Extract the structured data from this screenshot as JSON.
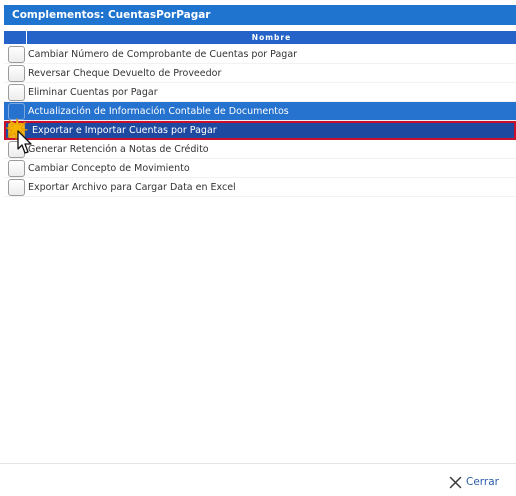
{
  "dialog": {
    "title": "Complementos: CuentasPorPagar"
  },
  "grid": {
    "header": "Nombre",
    "rows": [
      {
        "label": "Cambiar Número de Comprobante de Cuentas por Pagar",
        "state": "normal"
      },
      {
        "label": "Reversar Cheque Devuelto de Proveedor",
        "state": "normal"
      },
      {
        "label": "Eliminar Cuentas por Pagar",
        "state": "normal"
      },
      {
        "label": "Actualización de Información Contable de Documentos",
        "state": "highlighted"
      },
      {
        "label": "Exportar e Importar Cuentas por Pagar",
        "state": "selected"
      },
      {
        "label": "Generar Retención a Notas de Crédito",
        "state": "normal"
      },
      {
        "label": "Cambiar Concepto de Movimiento",
        "state": "normal"
      },
      {
        "label": "Exportar Archivo para Cargar Data en Excel",
        "state": "normal"
      }
    ]
  },
  "footer": {
    "close_label": "Cerrar"
  },
  "colors": {
    "title_bg": "#1f74d0",
    "header_bg": "#2563c8",
    "highlight_bg": "#2672cf",
    "selected_bg": "#1d4aa0",
    "selected_border": "#c8102e",
    "link": "#2b5da8"
  },
  "icons": {
    "close": "close-x-icon",
    "cursor": "mouse-pointer-icon",
    "click": "click-burst-icon"
  }
}
